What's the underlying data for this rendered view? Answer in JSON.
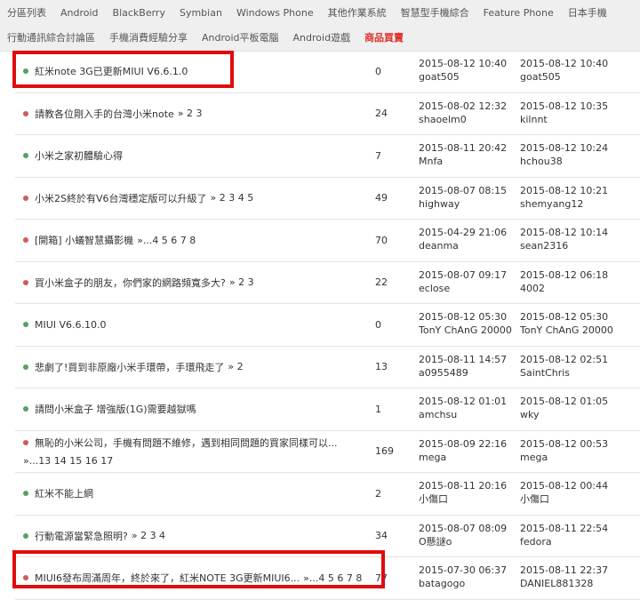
{
  "nav": {
    "row1": [
      "分區列表",
      "Android",
      "BlackBerry",
      "Symbian",
      "Windows Phone",
      "其他作業系統",
      "智慧型手機綜合",
      "Feature Phone",
      "日本手機"
    ],
    "row2": [
      "行動通訊綜合討論區",
      "手機消費經驗分享",
      "Android平板電腦",
      "Android遊戲",
      "商品買賣"
    ]
  },
  "threads": [
    {
      "title": "紅米note 3G已更新MIUI V6.6.1.0",
      "pages": "",
      "replies": "0",
      "post_time": "2015-08-12 10:40",
      "author": "goat505",
      "last_time": "2015-08-12 10:40",
      "last_user": "goat505",
      "dot": "green"
    },
    {
      "title": "請教各位剛入手的台灣小米note",
      "pages": "» 2 3",
      "replies": "24",
      "post_time": "2015-08-02 12:32",
      "author": "shaoelm0",
      "last_time": "2015-08-12 10:35",
      "last_user": "kilnnt",
      "dot": "red"
    },
    {
      "title": "小米之家初體驗心得",
      "pages": "",
      "replies": "7",
      "post_time": "2015-08-11 20:42",
      "author": "Mnfa",
      "last_time": "2015-08-12 10:24",
      "last_user": "hchou38",
      "dot": "green"
    },
    {
      "title": "小米2S終於有V6台灣穩定版可以升級了",
      "pages": "» 2 3 4 5",
      "replies": "49",
      "post_time": "2015-08-07 08:15",
      "author": "highway",
      "last_time": "2015-08-12 10:21",
      "last_user": "shemyang12",
      "dot": "red"
    },
    {
      "title": "[開箱] 小蟻智慧攝影機",
      "pages": "»...4 5 6 7 8",
      "replies": "70",
      "post_time": "2015-04-29 21:06",
      "author": "deanma",
      "last_time": "2015-08-12 10:14",
      "last_user": "sean2316",
      "dot": "red"
    },
    {
      "title": "買小米盒子的朋友，你們家的網路頻寬多大?",
      "pages": "» 2 3",
      "replies": "22",
      "post_time": "2015-08-07 09:17",
      "author": "eclose",
      "last_time": "2015-08-12 06:18",
      "last_user": "4002",
      "dot": "red"
    },
    {
      "title": "MIUI V6.6.10.0",
      "pages": "",
      "replies": "0",
      "post_time": "2015-08-12 05:30",
      "author": "TonY ChAnG 20000",
      "last_time": "2015-08-12 05:30",
      "last_user": "TonY ChAnG 20000",
      "dot": "green"
    },
    {
      "title": "悲劇了!買到非原廠小米手環帶，手環飛走了",
      "pages": "» 2",
      "replies": "13",
      "post_time": "2015-08-11 14:57",
      "author": "a0955489",
      "last_time": "2015-08-12 02:51",
      "last_user": "SaintChris",
      "dot": "green"
    },
    {
      "title": "請問小米盒子 增強版(1G)需要越獄嗎",
      "pages": "",
      "replies": "1",
      "post_time": "2015-08-12 01:01",
      "author": "amchsu",
      "last_time": "2015-08-12 01:05",
      "last_user": "wky",
      "dot": "green"
    },
    {
      "title": "無恥的小米公司，手機有問題不維修，遇到相同問題的買家同樣可以...",
      "pages": "»...13 14 15 16 17",
      "replies": "169",
      "post_time": "2015-08-09 22:16",
      "author": "mega",
      "last_time": "2015-08-12 00:53",
      "last_user": "mega",
      "dot": "red",
      "two_line": true
    },
    {
      "title": "紅米不能上網",
      "pages": "",
      "replies": "2",
      "post_time": "2015-08-11 20:16",
      "author": "小傷口",
      "last_time": "2015-08-12 00:44",
      "last_user": "小傷口",
      "dot": "green"
    },
    {
      "title": "行動電源當緊急照明?",
      "pages": "» 2 3 4",
      "replies": "34",
      "post_time": "2015-08-07 08:09",
      "author": "O懸謎o",
      "last_time": "2015-08-11 22:54",
      "last_user": "fedora",
      "dot": "green"
    },
    {
      "title": "MIUI6發布周滿周年，終於來了，紅米NOTE 3G更新MIUI6...",
      "pages": "»...4 5 6 7 8",
      "replies": "77",
      "post_time": "2015-07-30 06:37",
      "author": "batagogo",
      "last_time": "2015-08-11 22:37",
      "last_user": "DANIEL881328",
      "dot": "red"
    }
  ]
}
